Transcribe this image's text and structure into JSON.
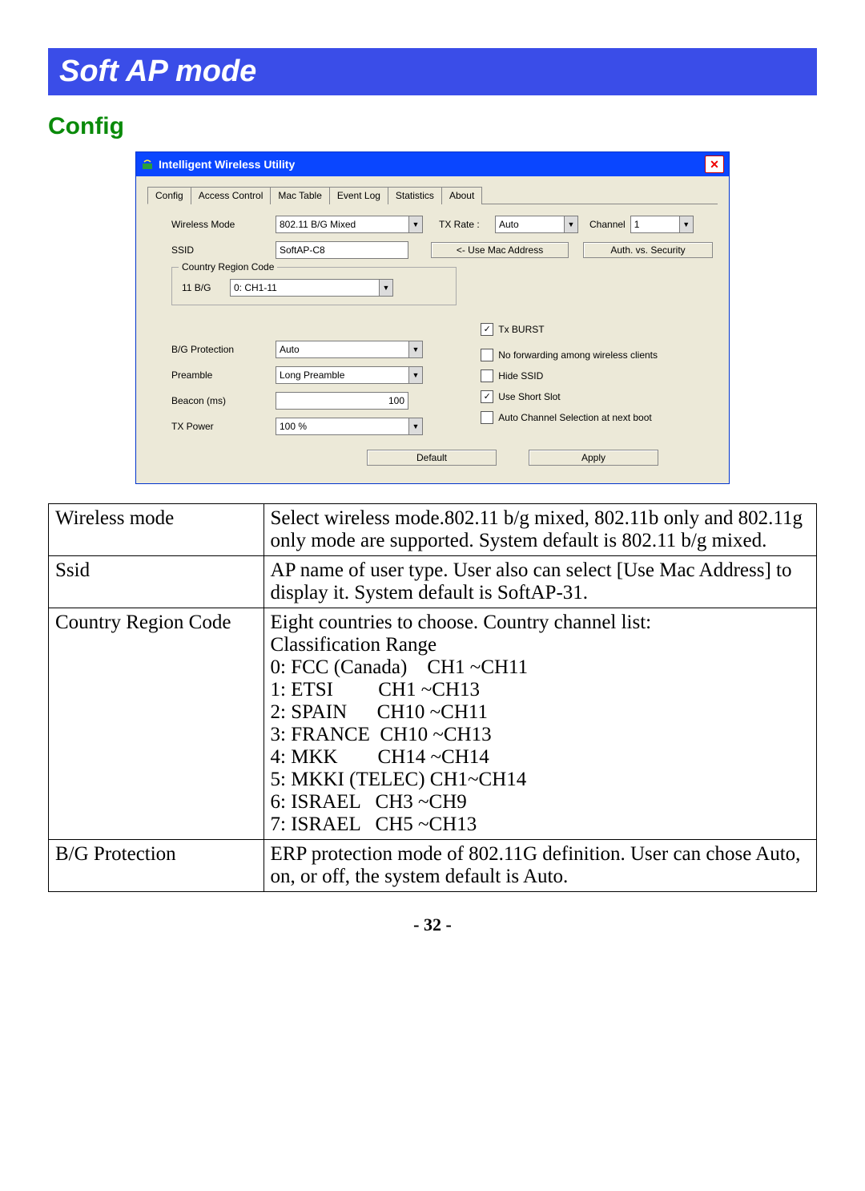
{
  "banner": "Soft AP mode",
  "subhead": "Config",
  "dialog": {
    "title": "Intelligent Wireless Utility",
    "tabs": [
      "Config",
      "Access Control",
      "Mac Table",
      "Event Log",
      "Statistics",
      "About"
    ],
    "wireless_mode_label": "Wireless Mode",
    "wireless_mode_value": "802.11 B/G Mixed",
    "tx_rate_label": "TX Rate :",
    "tx_rate_value": "Auto",
    "channel_label": "Channel",
    "channel_value": "1",
    "ssid_label": "SSID",
    "ssid_value": "SoftAP-C8",
    "use_mac_btn": "<- Use Mac Address",
    "auth_btn": "Auth. vs. Security",
    "group_title": "Country Region Code",
    "group_11bg_label": "11 B/G",
    "group_11bg_value": "0: CH1-11",
    "txburst_label": "Tx BURST",
    "bg_prot_label": "B/G Protection",
    "bg_prot_value": "Auto",
    "no_fwd_label": "No forwarding among wireless clients",
    "preamble_label": "Preamble",
    "preamble_value": "Long Preamble",
    "hide_ssid_label": "Hide SSID",
    "beacon_label": "Beacon (ms)",
    "beacon_value": "100",
    "short_slot_label": "Use Short Slot",
    "tx_power_label": "TX Power",
    "tx_power_value": "100 %",
    "auto_chan_label": "Auto Channel Selection at next boot",
    "default_btn": "Default",
    "apply_btn": "Apply"
  },
  "table": {
    "rows": [
      {
        "k": "Wireless mode",
        "v": "Select wireless mode.802.11 b/g mixed, 802.11b only and 802.11g only mode are supported. System default is 802.11 b/g mixed."
      },
      {
        "k": "Ssid",
        "v": "AP name of user type. User also can select [Use Mac Address] to display it. System default is SoftAP-31."
      },
      {
        "k": "Country Region Code",
        "v": "Eight countries to choose. Country channel list:\nClassification Range\n0: FCC (Canada)    CH1 ~CH11\n1: ETSI         CH1 ~CH13\n2: SPAIN      CH10 ~CH11\n3: FRANCE  CH10 ~CH13\n4: MKK        CH14 ~CH14\n5: MKKI (TELEC) CH1~CH14\n6: ISRAEL   CH3 ~CH9\n7: ISRAEL   CH5 ~CH13"
      },
      {
        "k": "B/G Protection",
        "v": "ERP protection mode of 802.11G definition. User can chose Auto, on, or off, the system default is Auto."
      }
    ]
  },
  "page_number": "- 32 -"
}
